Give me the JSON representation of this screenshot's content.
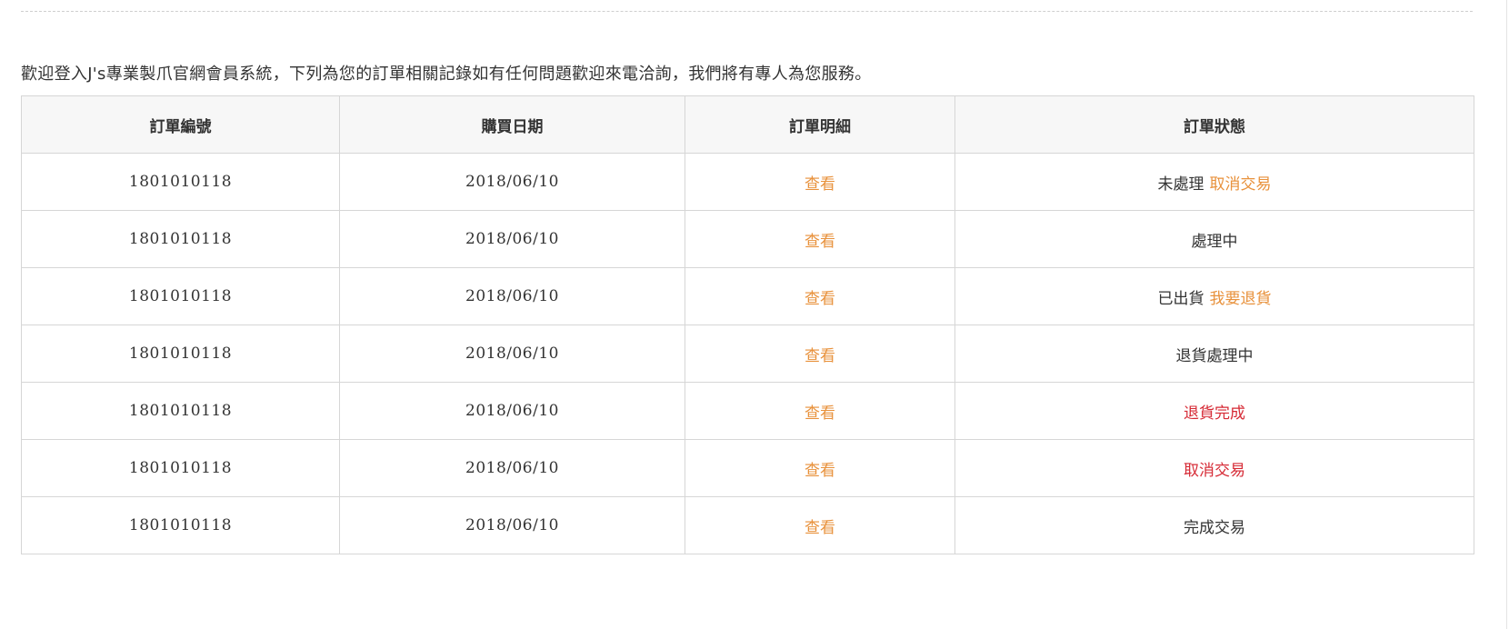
{
  "intro_text": "歡迎登入J's專業製爪官網會員系統，下列為您的訂單相關記錄如有任何問題歡迎來電洽詢，我們將有專人為您服務。",
  "table": {
    "headers": [
      "訂單編號",
      "購買日期",
      "訂單明細",
      "訂單狀態"
    ],
    "rows": [
      {
        "order_no": "1801010118",
        "date": "2018/06/10",
        "detail": "查看",
        "status": "未處理",
        "action": "取消交易"
      },
      {
        "order_no": "1801010118",
        "date": "2018/06/10",
        "detail": "查看",
        "status": "處理中",
        "action": ""
      },
      {
        "order_no": "1801010118",
        "date": "2018/06/10",
        "detail": "查看",
        "status": "已出貨",
        "action": "我要退貨"
      },
      {
        "order_no": "1801010118",
        "date": "2018/06/10",
        "detail": "查看",
        "status": "退貨處理中",
        "action": ""
      },
      {
        "order_no": "1801010118",
        "date": "2018/06/10",
        "detail": "查看",
        "status": "退貨完成",
        "action": ""
      },
      {
        "order_no": "1801010118",
        "date": "2018/06/10",
        "detail": "查看",
        "status": "取消交易",
        "action": ""
      },
      {
        "order_no": "1801010118",
        "date": "2018/06/10",
        "detail": "查看",
        "status": "完成交易",
        "action": ""
      }
    ]
  },
  "colors": {
    "link_orange": "#e8913b",
    "status_red": "#d62a35",
    "header_bg": "#f7f7f7",
    "border": "#d6d6d6"
  }
}
